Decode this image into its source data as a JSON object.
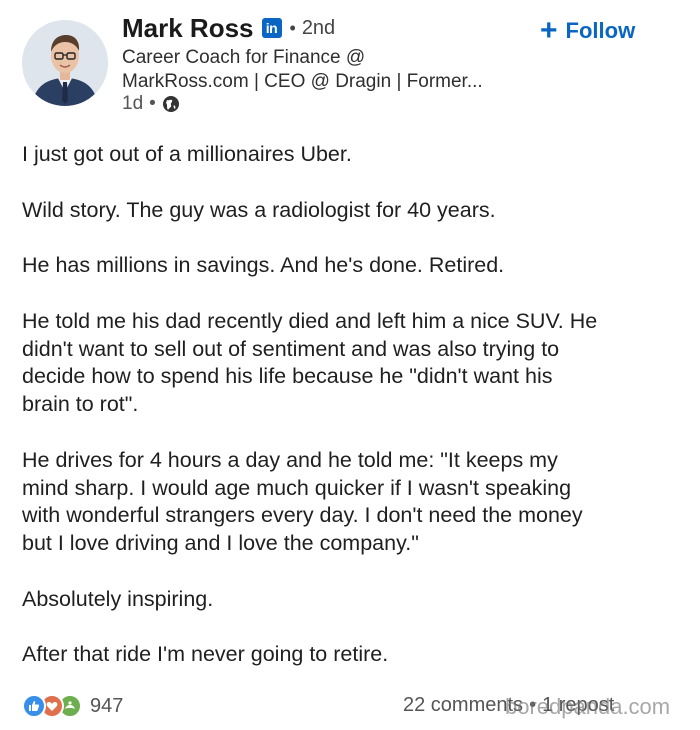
{
  "author": {
    "name": "Mark Ross",
    "degree": "2nd",
    "headline_line1": "Career Coach for Finance @",
    "headline_line2": "MarkRoss.com | CEO @ Dragin | Former...",
    "time": "1d"
  },
  "follow": {
    "label": "Follow",
    "plus": "+"
  },
  "post": {
    "paragraphs": [
      "I just got out of a millionaires Uber.",
      "Wild story. The guy was a radiologist for 40 years.",
      "He has millions in savings. And he's done. Retired.",
      "He told me his dad recently died and left him a nice SUV. He\ndidn't want to sell out of sentiment and was also trying to\ndecide how to spend his life because he \"didn't want his\nbrain to rot\".",
      "He drives for 4 hours a day and he told me: \"It keeps my\nmind sharp. I would age much quicker if I wasn't speaking\nwith wonderful strangers every day. I don't need the money\nbut I love driving and I love the company.\"",
      "Absolutely inspiring.",
      "After that ride I'm never going to retire."
    ]
  },
  "footer": {
    "reaction_count": "947",
    "comments": "22 comments",
    "reposts": "1 repost",
    "reaction_icons": [
      "like-icon",
      "love-icon",
      "support-icon"
    ]
  },
  "watermark": "boredpanda.com",
  "colors": {
    "linkedin_blue": "#0a66c2",
    "like": "#378fe9",
    "love": "#df704d",
    "support": "#6dae4f"
  }
}
